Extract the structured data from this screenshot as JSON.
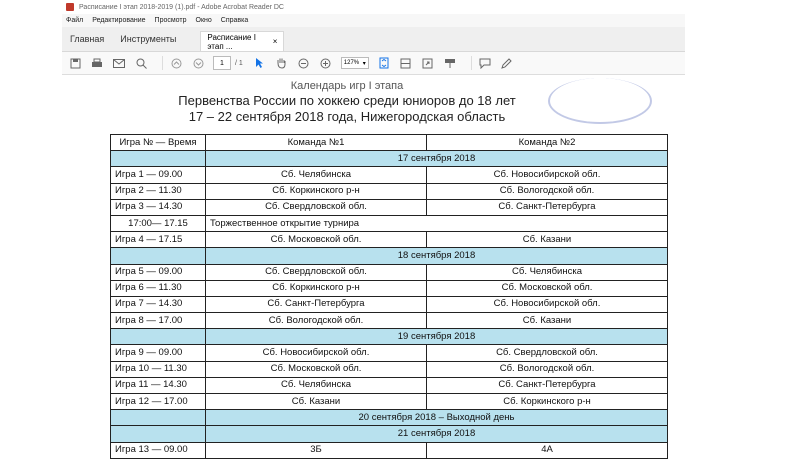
{
  "window": {
    "title": "Расписание I этап 2018-2019 (1).pdf - Adobe Acrobat Reader DC"
  },
  "menu": [
    "Файл",
    "Редактирование",
    "Просмотр",
    "Окно",
    "Справка"
  ],
  "tabs": {
    "home": "Главная",
    "tools": "Инструменты",
    "doc": "Расписание I этап ...",
    "close": "×"
  },
  "toolbar": {
    "page_current": "1",
    "page_total": "/ 1",
    "zoom": "127%"
  },
  "doc": {
    "title_partial": "Календарь игр I этапа",
    "title_line1": "Первенства России по хоккею среди юниоров до 18 лет",
    "title_line2": "17 – 22 сентября 2018 года, Нижегородская область"
  },
  "table": {
    "headers": [
      "Игра № — Время",
      "Команда №1",
      "Команда №2"
    ],
    "rows": [
      {
        "type": "date",
        "text": "17 сентября 2018"
      },
      {
        "type": "game",
        "game": "Игра 1 — 09.00",
        "team1": "Сб. Челябинска",
        "team2": "Сб. Новосибирской обл."
      },
      {
        "type": "game",
        "game": "Игра 2 — 11.30",
        "team1": "Сб. Коркинского р-н",
        "team2": "Сб. Вологодской обл."
      },
      {
        "type": "game",
        "game": "Игра 3 — 14.30",
        "team1": "Сб. Свердловской обл.",
        "team2": "Сб. Санкт-Петербурга"
      },
      {
        "type": "event",
        "time": "17:00— 17.15",
        "text": "Торжественное открытие турнира"
      },
      {
        "type": "game",
        "game": "Игра 4 — 17.15",
        "team1": "Сб. Московской обл.",
        "team2": "Сб. Казани"
      },
      {
        "type": "date",
        "text": "18 сентября 2018"
      },
      {
        "type": "game",
        "game": "Игра 5 — 09.00",
        "team1": "Сб. Свердловской обл.",
        "team2": "Сб. Челябинска"
      },
      {
        "type": "game",
        "game": "Игра 6 — 11.30",
        "team1": "Сб. Коркинского р-н",
        "team2": "Сб. Московской обл."
      },
      {
        "type": "game",
        "game": "Игра 7 — 14.30",
        "team1": "Сб. Санкт-Петербурга",
        "team2": "Сб. Новосибирской обл."
      },
      {
        "type": "game",
        "game": "Игра 8 — 17.00",
        "team1": "Сб. Вологодской обл.",
        "team2": "Сб. Казани"
      },
      {
        "type": "date",
        "text": "19 сентября 2018"
      },
      {
        "type": "game",
        "game": "Игра 9 — 09.00",
        "team1": "Сб. Новосибирской обл.",
        "team2": "Сб. Свердловской обл."
      },
      {
        "type": "game",
        "game": "Игра 10 — 11.30",
        "team1": "Сб. Московской обл.",
        "team2": "Сб. Вологодской обл."
      },
      {
        "type": "game",
        "game": "Игра 11 — 14.30",
        "team1": "Сб. Челябинска",
        "team2": "Сб. Санкт-Петербурга"
      },
      {
        "type": "game",
        "game": "Игра 12 — 17.00",
        "team1": "Сб. Казани",
        "team2": "Сб. Коркинского р-н"
      },
      {
        "type": "date",
        "text": "20 сентября 2018 – Выходной день"
      },
      {
        "type": "date",
        "text": "21 сентября 2018"
      },
      {
        "type": "game",
        "game": "Игра 13 — 09.00",
        "team1": "3Б",
        "team2": "4А"
      }
    ]
  },
  "colors": {
    "date_row_bg": "#b8e1ee",
    "accent": "#1473e6"
  }
}
